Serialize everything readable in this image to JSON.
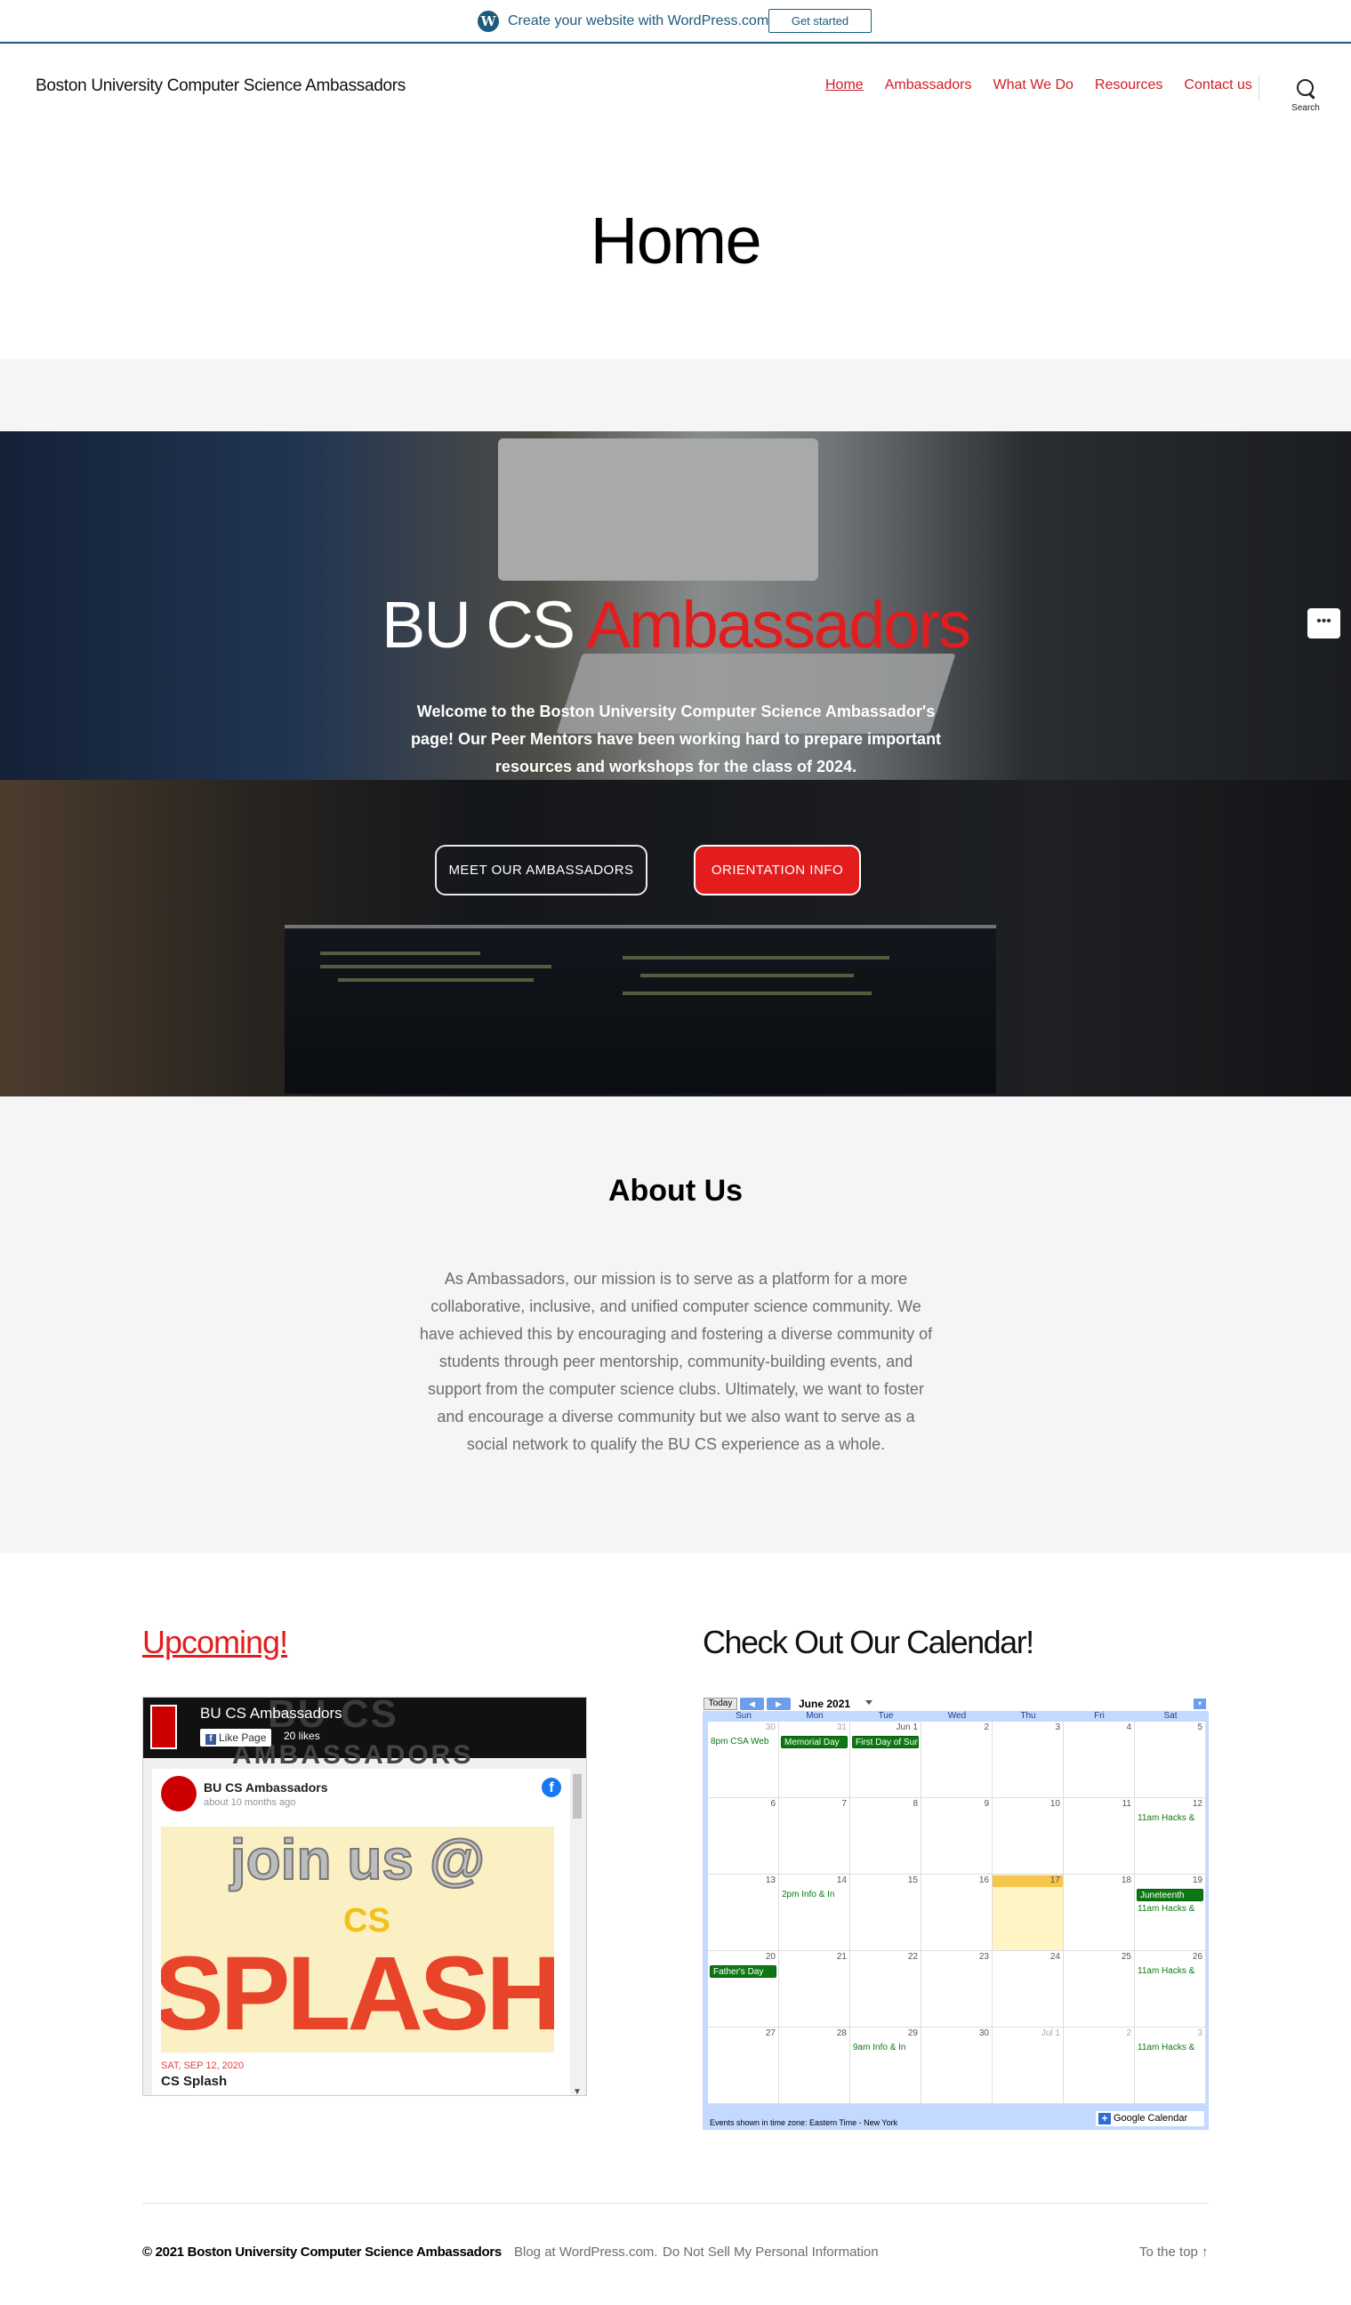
{
  "wp_banner": {
    "text": "Create your website with WordPress.com",
    "button": "Get started"
  },
  "header": {
    "site_title": "Boston University Computer Science Ambassadors",
    "nav": [
      "Home",
      "Ambassadors",
      "What We Do",
      "Resources",
      "Contact us"
    ],
    "active_nav": "Home",
    "search_label": "Search"
  },
  "page_title": "Home",
  "hero": {
    "title_plain": "BU CS",
    "title_red": "Ambassadors",
    "welcome": "Welcome to the Boston University Computer Science Ambassador's page! Our Peer Mentors have been working hard to prepare important resources and workshops for the class of 2024.",
    "button_meet": "MEET OUR AMBASSADORS",
    "button_orientation": "ORIENTATION INFO",
    "more_label": "•••"
  },
  "about": {
    "heading": "About Us",
    "body": "As Ambassadors, our mission is to serve as a platform for a more collaborative, inclusive, and unified computer science community. We have achieved this by encouraging and fostering a diverse community of students through peer mentorship, community-building events, and support from the computer science clubs. Ultimately, we want to foster and encourage a diverse community but we also want to serve as a social network to qualify the BU CS experience as a whole."
  },
  "upcoming": {
    "heading": "Upcoming!",
    "fb": {
      "page_name": "BU CS Ambassadors",
      "like_button": "Like Page",
      "likes": "20 likes",
      "cover_text_1": "BU CS",
      "cover_text_2": "AMBASSADORS",
      "post_author": "BU CS Ambassadors",
      "post_time": "about 10 months ago",
      "post_image_text_1": "join us @",
      "post_image_text_2": "CS",
      "post_image_text_3": "SPLASH",
      "event_date": "SAT, SEP 12, 2020",
      "event_title": "CS Splash"
    }
  },
  "calendar": {
    "heading": "Check Out Our Calendar!",
    "today_button": "Today",
    "month": "June 2021",
    "weekdays": [
      "Sun",
      "Mon",
      "Tue",
      "Wed",
      "Thu",
      "Fri",
      "Sat"
    ],
    "weeks": [
      [
        {
          "d": "30",
          "other": true,
          "events": [
            {
              "text": "8pm CSA Web",
              "bar": false
            }
          ]
        },
        {
          "d": "31",
          "other": true,
          "events": [
            {
              "text": "Memorial Day",
              "bar": true
            }
          ]
        },
        {
          "d": "Jun 1",
          "events": [
            {
              "text": "First Day of Summer",
              "bar": true
            }
          ]
        },
        {
          "d": "2"
        },
        {
          "d": "3"
        },
        {
          "d": "4"
        },
        {
          "d": "5"
        }
      ],
      [
        {
          "d": "6"
        },
        {
          "d": "7"
        },
        {
          "d": "8"
        },
        {
          "d": "9"
        },
        {
          "d": "10"
        },
        {
          "d": "11"
        },
        {
          "d": "12",
          "events": [
            {
              "text": "11am Hacks &",
              "bar": false
            }
          ]
        }
      ],
      [
        {
          "d": "13"
        },
        {
          "d": "14",
          "events": [
            {
              "text": "2pm Info & In",
              "bar": false
            }
          ]
        },
        {
          "d": "15"
        },
        {
          "d": "16"
        },
        {
          "d": "17",
          "today": true
        },
        {
          "d": "18"
        },
        {
          "d": "19",
          "events": [
            {
              "text": "Juneteenth",
              "bar": true
            },
            {
              "text": "11am Hacks &",
              "bar": false
            }
          ]
        }
      ],
      [
        {
          "d": "20",
          "events": [
            {
              "text": "Father's Day",
              "bar": true
            }
          ]
        },
        {
          "d": "21"
        },
        {
          "d": "22"
        },
        {
          "d": "23"
        },
        {
          "d": "24"
        },
        {
          "d": "25"
        },
        {
          "d": "26",
          "events": [
            {
              "text": "11am Hacks &",
              "bar": false
            }
          ]
        }
      ],
      [
        {
          "d": "27"
        },
        {
          "d": "28"
        },
        {
          "d": "29",
          "events": [
            {
              "text": "9am Info & In",
              "bar": false
            }
          ]
        },
        {
          "d": "30"
        },
        {
          "d": "Jul 1",
          "other": true
        },
        {
          "d": "2",
          "other": true
        },
        {
          "d": "3",
          "other": true,
          "events": [
            {
              "text": "11am Hacks &",
              "bar": false
            }
          ]
        }
      ]
    ],
    "timezone_note": "Events shown in time zone: Eastern Time - New York",
    "google_label": "Google Calendar"
  },
  "footer": {
    "copyright": "© 2021 Boston University Computer Science Ambassadors",
    "blog": "Blog at WordPress.com.",
    "do_not_sell": "Do Not Sell My Personal Information",
    "to_top": "To the top ↑"
  },
  "colors": {
    "accent_red": "#cd2026",
    "hero_red": "#e31d1d",
    "wp_blue": "#1e5a7c",
    "calendar_green": "#0d7813"
  }
}
